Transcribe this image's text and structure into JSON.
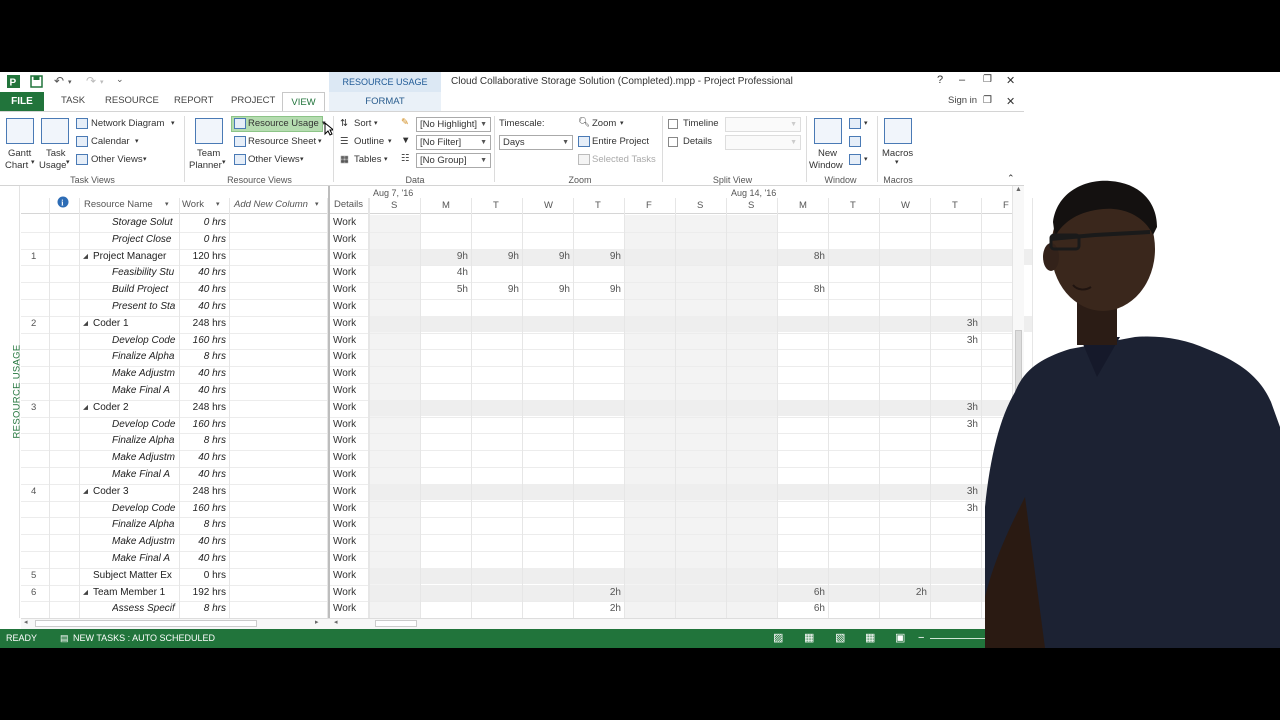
{
  "window": {
    "context_tools": "RESOURCE USAGE TOOLS",
    "title": "Cloud Collaborative Storage Solution (Completed).mpp - Project Professional",
    "help": "?",
    "sign_in": "Sign in"
  },
  "tabs": [
    "FILE",
    "TASK",
    "RESOURCE",
    "REPORT",
    "PROJECT",
    "VIEW",
    "FORMAT"
  ],
  "ribbon": {
    "task_views": {
      "label": "Task Views",
      "gantt": "Gantt",
      "chart": "Chart",
      "task": "Task",
      "usage": "Usage",
      "network": "Network Diagram",
      "calendar": "Calendar",
      "other": "Other Views"
    },
    "resource_views": {
      "label": "Resource Views",
      "team": "Team",
      "planner": "Planner",
      "usage": "Resource Usage",
      "sheet": "Resource Sheet",
      "other": "Other Views"
    },
    "data": {
      "label": "Data",
      "sort": "Sort",
      "outline": "Outline",
      "tables": "Tables",
      "highlight": "[No Highlight]",
      "filter": "[No Filter]",
      "group": "[No Group]"
    },
    "zoom": {
      "label": "Zoom",
      "timescale_label": "Timescale:",
      "timescale": "Days",
      "zoom": "Zoom",
      "entire": "Entire Project",
      "selected": "Selected Tasks"
    },
    "split": {
      "label": "Split View",
      "timeline": "Timeline",
      "details": "Details"
    },
    "window": {
      "label": "Window",
      "new": "New",
      "window": "Window"
    },
    "macros": {
      "label": "Macros",
      "macros": "Macros"
    }
  },
  "view_label": "RESOURCE USAGE",
  "columns": {
    "info": "i",
    "name": "Resource Name",
    "work": "Work",
    "add": "Add New Column",
    "details": "Details"
  },
  "timescale": {
    "weeks": [
      "Aug 7, '16",
      "Aug 14, '16"
    ],
    "days": [
      "S",
      "M",
      "T",
      "W",
      "T",
      "F",
      "S",
      "S",
      "M",
      "T",
      "W",
      "T",
      "F"
    ]
  },
  "rows": [
    {
      "id": "",
      "name": "Storage Solut",
      "work": "0 hrs",
      "type": "task",
      "details": "Work",
      "cells": [
        "",
        "",
        "",
        "",
        "",
        "",
        "",
        "",
        "",
        "",
        "",
        "",
        ""
      ]
    },
    {
      "id": "",
      "name": "Project Close",
      "work": "0 hrs",
      "type": "task",
      "details": "Work",
      "cells": [
        "",
        "",
        "",
        "",
        "",
        "",
        "",
        "",
        "",
        "",
        "",
        "",
        ""
      ]
    },
    {
      "id": "1",
      "name": "Project Manager",
      "work": "120 hrs",
      "type": "resource",
      "details": "Work",
      "cells": [
        "",
        "9h",
        "9h",
        "9h",
        "9h",
        "",
        "",
        "",
        "8h",
        "",
        "",
        "",
        ""
      ]
    },
    {
      "id": "",
      "name": "Feasibility Stu",
      "work": "40 hrs",
      "type": "task",
      "details": "Work",
      "cells": [
        "",
        "4h",
        "",
        "",
        "",
        "",
        "",
        "",
        "",
        "",
        "",
        "",
        ""
      ]
    },
    {
      "id": "",
      "name": "Build Project",
      "work": "40 hrs",
      "type": "task",
      "details": "Work",
      "cells": [
        "",
        "5h",
        "9h",
        "9h",
        "9h",
        "",
        "",
        "",
        "8h",
        "",
        "",
        "",
        ""
      ]
    },
    {
      "id": "",
      "name": "Present to Sta",
      "work": "40 hrs",
      "type": "task",
      "details": "Work",
      "cells": [
        "",
        "",
        "",
        "",
        "",
        "",
        "",
        "",
        "",
        "",
        "",
        "",
        ""
      ]
    },
    {
      "id": "2",
      "name": "Coder 1",
      "work": "248 hrs",
      "type": "resource",
      "details": "Work",
      "cells": [
        "",
        "",
        "",
        "",
        "",
        "",
        "",
        "",
        "",
        "",
        "",
        "3h",
        ""
      ]
    },
    {
      "id": "",
      "name": "Develop Code",
      "work": "160 hrs",
      "type": "task",
      "details": "Work",
      "cells": [
        "",
        "",
        "",
        "",
        "",
        "",
        "",
        "",
        "",
        "",
        "",
        "3h",
        ""
      ]
    },
    {
      "id": "",
      "name": "Finalize Alpha",
      "work": "8 hrs",
      "type": "task",
      "details": "Work",
      "cells": [
        "",
        "",
        "",
        "",
        "",
        "",
        "",
        "",
        "",
        "",
        "",
        "",
        ""
      ]
    },
    {
      "id": "",
      "name": "Make Adjustm",
      "work": "40 hrs",
      "type": "task",
      "details": "Work",
      "cells": [
        "",
        "",
        "",
        "",
        "",
        "",
        "",
        "",
        "",
        "",
        "",
        "",
        ""
      ]
    },
    {
      "id": "",
      "name": "Make Final A",
      "work": "40 hrs",
      "type": "task",
      "details": "Work",
      "cells": [
        "",
        "",
        "",
        "",
        "",
        "",
        "",
        "",
        "",
        "",
        "",
        "",
        ""
      ]
    },
    {
      "id": "3",
      "name": "Coder 2",
      "work": "248 hrs",
      "type": "resource",
      "details": "Work",
      "cells": [
        "",
        "",
        "",
        "",
        "",
        "",
        "",
        "",
        "",
        "",
        "",
        "3h",
        ""
      ]
    },
    {
      "id": "",
      "name": "Develop Code",
      "work": "160 hrs",
      "type": "task",
      "details": "Work",
      "cells": [
        "",
        "",
        "",
        "",
        "",
        "",
        "",
        "",
        "",
        "",
        "",
        "3h",
        ""
      ]
    },
    {
      "id": "",
      "name": "Finalize Alpha",
      "work": "8 hrs",
      "type": "task",
      "details": "Work",
      "cells": [
        "",
        "",
        "",
        "",
        "",
        "",
        "",
        "",
        "",
        "",
        "",
        "",
        ""
      ]
    },
    {
      "id": "",
      "name": "Make Adjustm",
      "work": "40 hrs",
      "type": "task",
      "details": "Work",
      "cells": [
        "",
        "",
        "",
        "",
        "",
        "",
        "",
        "",
        "",
        "",
        "",
        "",
        ""
      ]
    },
    {
      "id": "",
      "name": "Make Final A",
      "work": "40 hrs",
      "type": "task",
      "details": "Work",
      "cells": [
        "",
        "",
        "",
        "",
        "",
        "",
        "",
        "",
        "",
        "",
        "",
        "",
        ""
      ]
    },
    {
      "id": "4",
      "name": "Coder 3",
      "work": "248 hrs",
      "type": "resource",
      "details": "Work",
      "cells": [
        "",
        "",
        "",
        "",
        "",
        "",
        "",
        "",
        "",
        "",
        "",
        "3h",
        ""
      ]
    },
    {
      "id": "",
      "name": "Develop Code",
      "work": "160 hrs",
      "type": "task",
      "details": "Work",
      "cells": [
        "",
        "",
        "",
        "",
        "",
        "",
        "",
        "",
        "",
        "",
        "",
        "3h",
        ""
      ]
    },
    {
      "id": "",
      "name": "Finalize Alpha",
      "work": "8 hrs",
      "type": "task",
      "details": "Work",
      "cells": [
        "",
        "",
        "",
        "",
        "",
        "",
        "",
        "",
        "",
        "",
        "",
        "",
        ""
      ]
    },
    {
      "id": "",
      "name": "Make Adjustm",
      "work": "40 hrs",
      "type": "task",
      "details": "Work",
      "cells": [
        "",
        "",
        "",
        "",
        "",
        "",
        "",
        "",
        "",
        "",
        "",
        "",
        ""
      ]
    },
    {
      "id": "",
      "name": "Make Final A",
      "work": "40 hrs",
      "type": "task",
      "details": "Work",
      "cells": [
        "",
        "",
        "",
        "",
        "",
        "",
        "",
        "",
        "",
        "",
        "",
        "",
        ""
      ]
    },
    {
      "id": "5",
      "name": "Subject Matter Ex",
      "work": "0 hrs",
      "type": "resource-flat",
      "details": "Work",
      "cells": [
        "",
        "",
        "",
        "",
        "",
        "",
        "",
        "",
        "",
        "",
        "",
        "",
        ""
      ]
    },
    {
      "id": "6",
      "name": "Team Member 1",
      "work": "192 hrs",
      "type": "resource",
      "details": "Work",
      "cells": [
        "",
        "",
        "",
        "",
        "2h",
        "",
        "",
        "",
        "6h",
        "",
        "2h",
        "",
        ""
      ]
    },
    {
      "id": "",
      "name": "Assess Specif",
      "work": "8 hrs",
      "type": "task",
      "details": "Work",
      "cells": [
        "",
        "",
        "",
        "",
        "2h",
        "",
        "",
        "",
        "6h",
        "",
        "",
        "",
        ""
      ]
    }
  ],
  "status": {
    "ready": "READY",
    "new_tasks": "NEW TASKS : AUTO SCHEDULED"
  },
  "colors": {
    "accent": "#21743b",
    "ctx_blue": "#dce8f4",
    "highlight": "#b5dcb0"
  }
}
